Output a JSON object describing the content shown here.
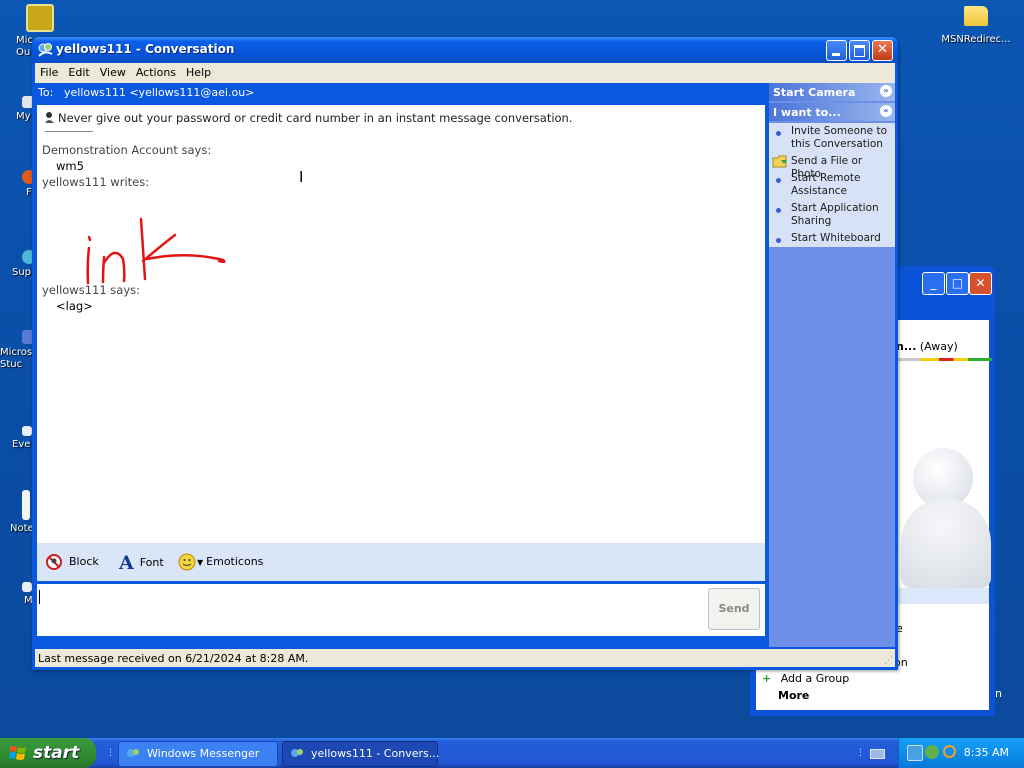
{
  "desktop": {
    "icons_left": [
      {
        "label": "Mic\nOu"
      },
      {
        "label": "My"
      },
      {
        "label": "F"
      },
      {
        "label": "Sup"
      },
      {
        "label": "Micros\nStuc"
      },
      {
        "label": "Eve"
      },
      {
        "label": "Note"
      },
      {
        "label": "M"
      }
    ],
    "icon_right": {
      "label": "MSNRedirec..."
    }
  },
  "window": {
    "title": "yellows111 - Conversation",
    "menu": [
      "File",
      "Edit",
      "View",
      "Actions",
      "Help"
    ],
    "to_label": "To:",
    "to_address": "yellows111 <yellows111@aei.ou>",
    "warning": "Never give out your password or credit card number in an instant message conversation.",
    "messages": [
      {
        "header": "Demonstration Account says:",
        "body": "wm5"
      },
      {
        "header": "yellows111 writes:",
        "body": ""
      },
      {
        "header": "yellows111 says:",
        "body": "<lag>"
      }
    ],
    "ink_text": "ink",
    "toolbar": {
      "block_label": "Block",
      "font_label": "Font",
      "emoticons_label": "Emoticons"
    },
    "send_label": "Send",
    "status_text": "Last message received on 6/21/2024 at 8:28 AM."
  },
  "pane": {
    "start_camera": "Start Camera",
    "i_want_to": "I want to...",
    "items": [
      {
        "label": "Invite Someone to this Conversation",
        "icon": "bullet"
      },
      {
        "label": "Send a File or Photo",
        "icon": "folder-icon"
      },
      {
        "label": "Start Remote Assistance",
        "icon": "bullet"
      },
      {
        "label": "Start Application Sharing",
        "icon": "bullet"
      },
      {
        "label": "Start Whiteboard",
        "icon": "bullet"
      }
    ]
  },
  "bg_window": {
    "status_name": "n...",
    "status_state": "(Away)",
    "links": [
      "e",
      "on"
    ],
    "add_group": "Add a Group",
    "more": "More",
    "edge_char": "n"
  },
  "taskbar": {
    "start_label": "start",
    "tasks": [
      {
        "label": "Windows Messenger",
        "active": false
      },
      {
        "label": "yellows111 - Convers...",
        "active": true
      }
    ],
    "clock": "8:35 AM"
  },
  "colors": {
    "window_blue": "#0a58e0",
    "ink_red": "#e01515",
    "taskbar_blue": "#245edb",
    "start_green": "#2f8a2f"
  }
}
